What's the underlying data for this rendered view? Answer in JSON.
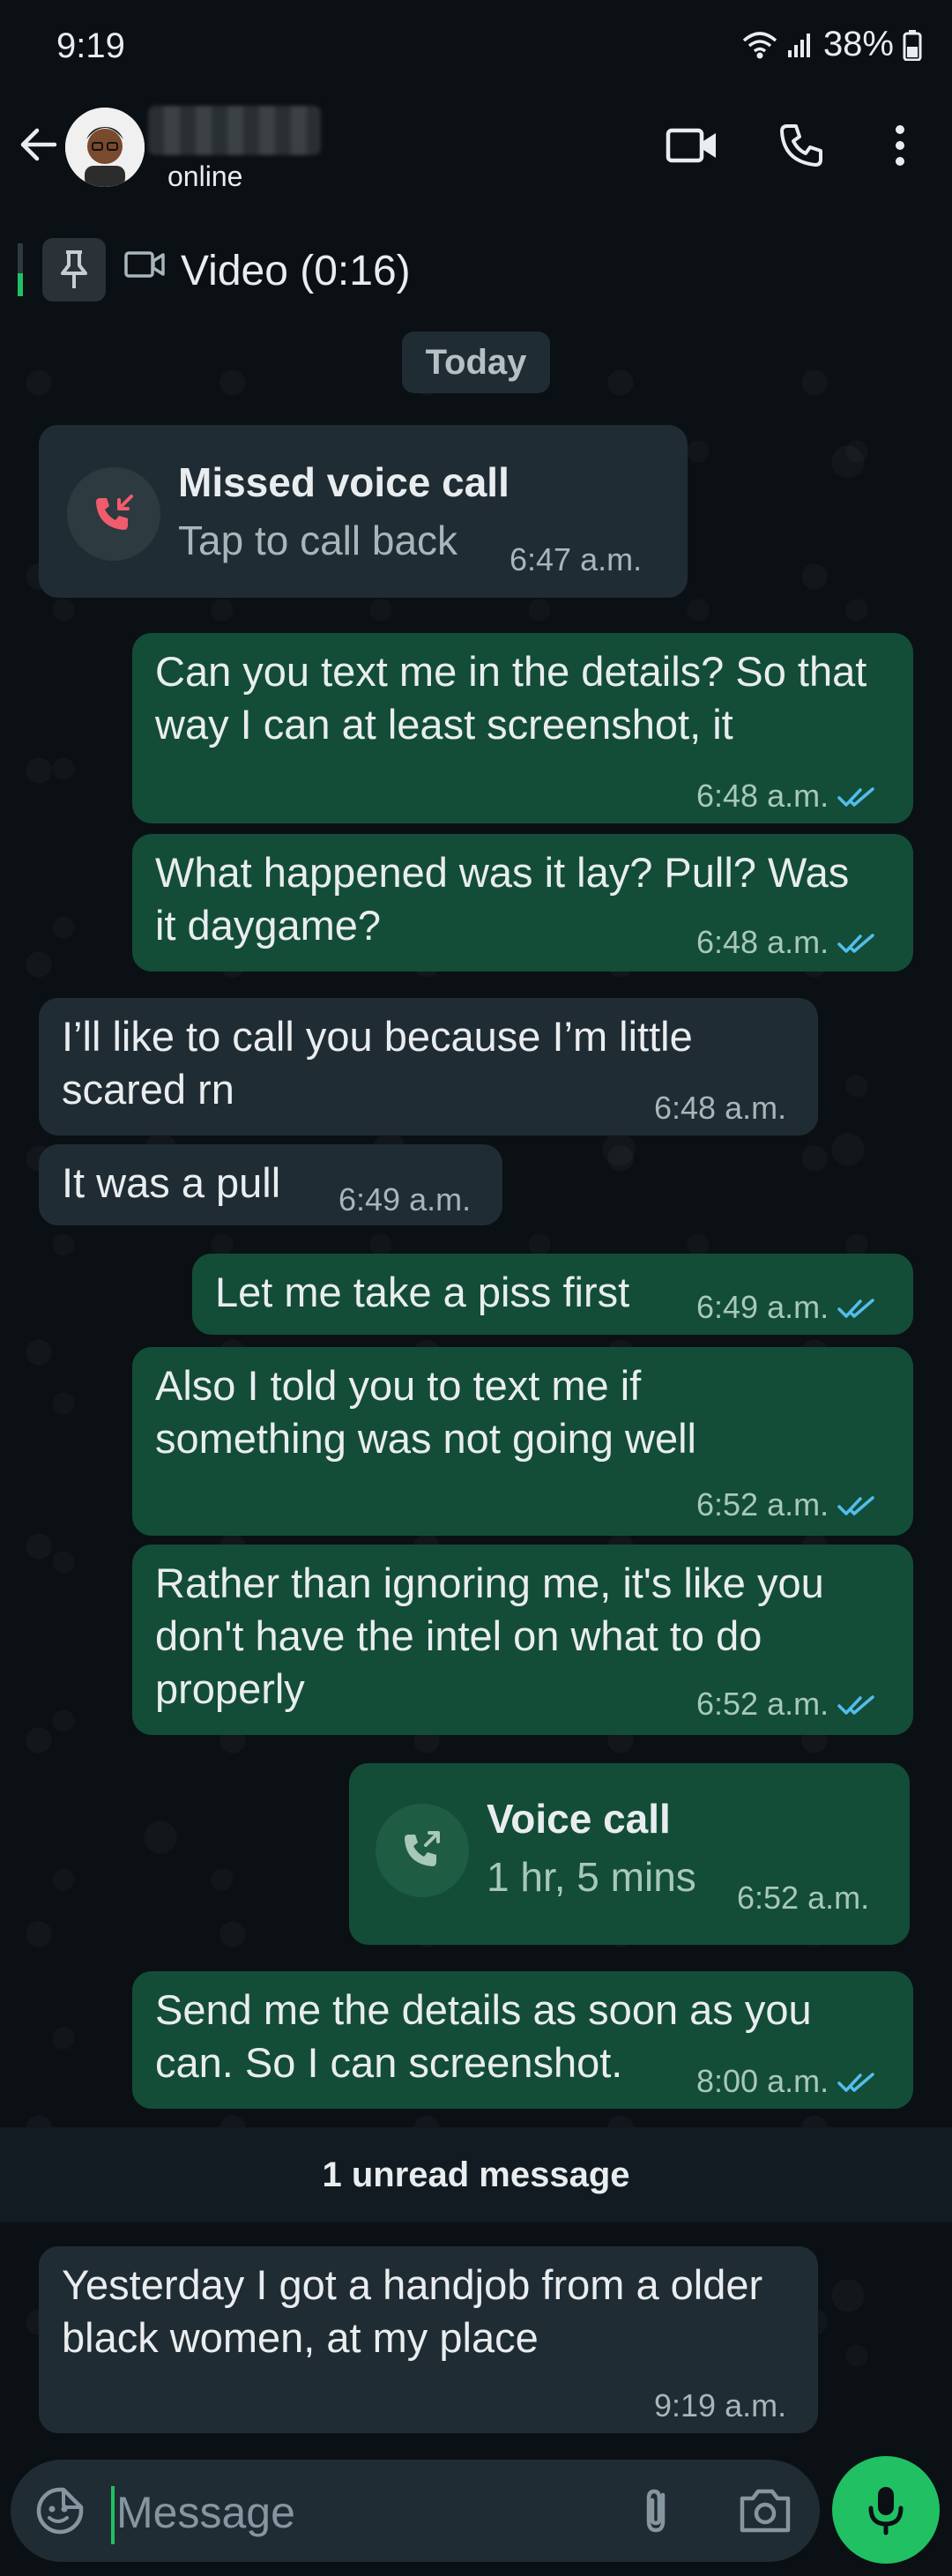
{
  "status_bar": {
    "time": "9:19",
    "battery": "38%"
  },
  "header": {
    "contact_status": "online"
  },
  "pinned": {
    "text": "Video (0:16)"
  },
  "chat": {
    "date_label": "Today",
    "missed_call": {
      "title": "Missed voice call",
      "subtitle": "Tap to call back",
      "time": "6:47 a.m."
    },
    "messages": [
      {
        "text": "Can you text me in the details? So that way I can at least screenshot, it",
        "time": "6:48 a.m."
      },
      {
        "text": "What happened was it lay? Pull? Was it daygame?",
        "time": "6:48 a.m."
      },
      {
        "text": "I’ll like to call you because I’m little scared rn",
        "time": "6:48 a.m."
      },
      {
        "text": "It was a pull",
        "time": "6:49 a.m."
      },
      {
        "text": "Let me take a piss first",
        "time": "6:49 a.m."
      },
      {
        "text": "Also I told you to text me if something was not going well",
        "time": "6:52 a.m."
      },
      {
        "text": "Rather than ignoring me, it's like you don't have the intel on what to do properly",
        "time": "6:52 a.m."
      },
      {
        "text": "Send me the details as soon as you can. So I can screenshot.",
        "time": "8:00 a.m."
      },
      {
        "text": "Yesterday I got a handjob from a older black women, at my place",
        "time": "9:19 a.m."
      }
    ],
    "voice_call": {
      "title": "Voice call",
      "duration": "1 hr, 5 mins",
      "time": "6:52 a.m."
    },
    "unread_label": "1 unread message"
  },
  "composer": {
    "placeholder": "Message"
  },
  "colors": {
    "outgoing_bubble": "#134d37",
    "incoming_bubble": "#202c33",
    "accent": "#21c063",
    "read_ticks": "#53bdeb"
  }
}
